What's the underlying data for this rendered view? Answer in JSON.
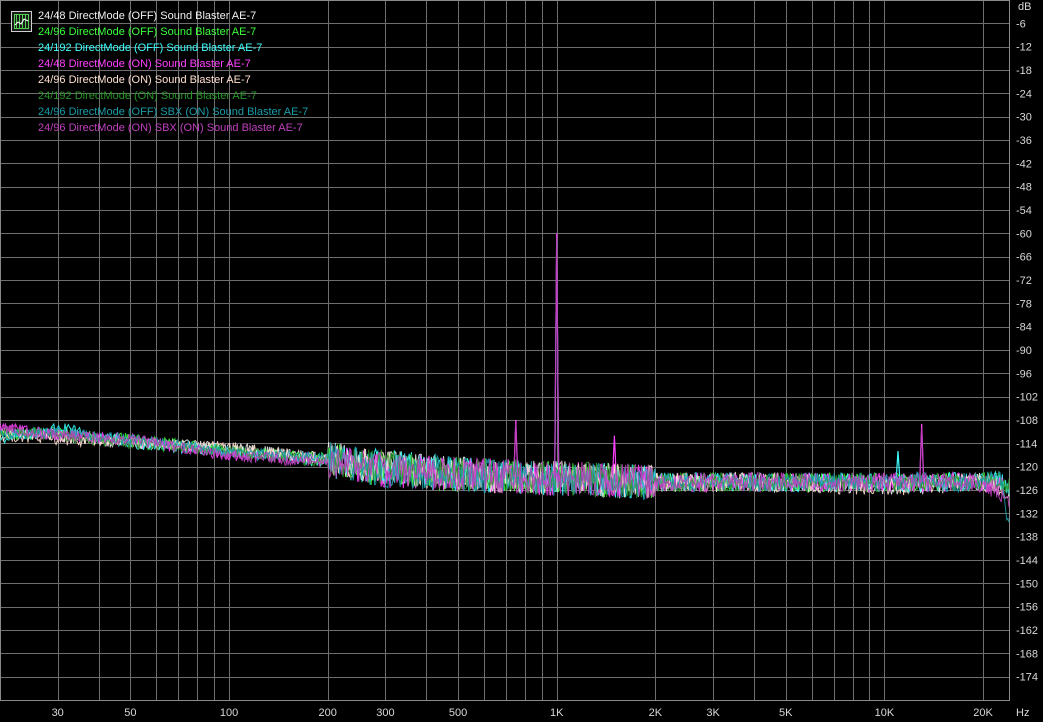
{
  "chart_data": {
    "type": "line",
    "title": "",
    "x_unit": "Hz",
    "y_unit": "dB",
    "x_scale": "log",
    "xlim": [
      20,
      24000
    ],
    "ylim": [
      -180,
      0
    ],
    "grid": true,
    "legend_position": "top-left",
    "x_ticks": [
      {
        "value": 30,
        "label": "30"
      },
      {
        "value": 50,
        "label": "50"
      },
      {
        "value": 100,
        "label": "100"
      },
      {
        "value": 200,
        "label": "200"
      },
      {
        "value": 300,
        "label": "300"
      },
      {
        "value": 500,
        "label": "500"
      },
      {
        "value": 1000,
        "label": "1K"
      },
      {
        "value": 2000,
        "label": "2K"
      },
      {
        "value": 3000,
        "label": "3K"
      },
      {
        "value": 5000,
        "label": "5K"
      },
      {
        "value": 10000,
        "label": "10K"
      },
      {
        "value": 20000,
        "label": "20K"
      }
    ],
    "y_ticks": [
      -6,
      -12,
      -18,
      -24,
      -30,
      -36,
      -42,
      -48,
      -54,
      -60,
      -66,
      -72,
      -78,
      -84,
      -90,
      -96,
      -102,
      -108,
      -114,
      -120,
      -126,
      -132,
      -138,
      -144,
      -150,
      -156,
      -162,
      -168,
      -174
    ],
    "series": [
      {
        "name": "24/48 DirectMode (OFF) Sound Blaster AE-7",
        "color": "#f0f0f0",
        "points": [
          [
            20,
            -111
          ],
          [
            30,
            -112
          ],
          [
            50,
            -114
          ],
          [
            100,
            -115
          ],
          [
            200,
            -118
          ],
          [
            300,
            -120
          ],
          [
            500,
            -122
          ],
          [
            1000,
            -123
          ],
          [
            2000,
            -124
          ],
          [
            5000,
            -124
          ],
          [
            10000,
            -125
          ],
          [
            20000,
            -124
          ],
          [
            23000,
            -125
          ]
        ],
        "spikes": []
      },
      {
        "name": "24/96 DirectMode (OFF) Sound Blaster AE-7",
        "color": "#3cff3c",
        "points": [
          [
            20,
            -112
          ],
          [
            30,
            -111
          ],
          [
            50,
            -113
          ],
          [
            100,
            -116
          ],
          [
            200,
            -118
          ],
          [
            300,
            -121
          ],
          [
            500,
            -122
          ],
          [
            1000,
            -123
          ],
          [
            2000,
            -124
          ],
          [
            5000,
            -124
          ],
          [
            10000,
            -124
          ],
          [
            20000,
            -124
          ],
          [
            22500,
            -123
          ],
          [
            24000,
            -127
          ]
        ],
        "spikes": []
      },
      {
        "name": "24/192 DirectMode (OFF) Sound Blaster AE-7",
        "color": "#3cffff",
        "points": [
          [
            20,
            -113
          ],
          [
            30,
            -110
          ],
          [
            50,
            -114
          ],
          [
            100,
            -116
          ],
          [
            200,
            -119
          ],
          [
            300,
            -120
          ],
          [
            500,
            -122
          ],
          [
            1000,
            -123
          ],
          [
            2000,
            -124
          ],
          [
            5000,
            -124
          ],
          [
            10000,
            -124
          ],
          [
            20000,
            -124
          ],
          [
            22500,
            -123
          ],
          [
            24000,
            -126
          ]
        ],
        "spikes": [
          [
            11000,
            -116
          ]
        ]
      },
      {
        "name": "24/48 DirectMode (ON) Sound Blaster AE-7",
        "color": "#ff40ff",
        "points": [
          [
            20,
            -110
          ],
          [
            30,
            -112
          ],
          [
            50,
            -113
          ],
          [
            100,
            -117
          ],
          [
            200,
            -118
          ],
          [
            300,
            -121
          ],
          [
            500,
            -122
          ],
          [
            1000,
            -123
          ],
          [
            2000,
            -124
          ],
          [
            5000,
            -124
          ],
          [
            10000,
            -124
          ],
          [
            20000,
            -124
          ],
          [
            23000,
            -125
          ]
        ],
        "spikes": [
          [
            1000,
            -60
          ],
          [
            750,
            -108
          ],
          [
            1500,
            -112
          ],
          [
            13000,
            -109
          ]
        ]
      },
      {
        "name": "24/96 DirectMode (ON) Sound Blaster AE-7",
        "color": "#ffe0d0",
        "points": [
          [
            20,
            -112
          ],
          [
            30,
            -113
          ],
          [
            50,
            -114
          ],
          [
            100,
            -115
          ],
          [
            200,
            -118
          ],
          [
            300,
            -120
          ],
          [
            500,
            -122
          ],
          [
            1000,
            -123
          ],
          [
            2000,
            -124
          ],
          [
            5000,
            -124
          ],
          [
            10000,
            -125
          ],
          [
            20000,
            -124
          ],
          [
            24000,
            -126
          ]
        ],
        "spikes": []
      },
      {
        "name": "24/192 DirectMode (ON) Sound Blaster AE-7",
        "color": "#289628",
        "points": [
          [
            20,
            -111
          ],
          [
            30,
            -112
          ],
          [
            50,
            -114
          ],
          [
            100,
            -116
          ],
          [
            200,
            -119
          ],
          [
            300,
            -120
          ],
          [
            500,
            -122
          ],
          [
            1000,
            -123
          ],
          [
            2000,
            -124
          ],
          [
            5000,
            -124
          ],
          [
            10000,
            -124
          ],
          [
            20000,
            -124
          ],
          [
            24000,
            -125
          ]
        ],
        "spikes": []
      },
      {
        "name": "24/96 DirectMode (OFF) SBX (ON) Sound Blaster AE-7",
        "color": "#1a9aa8",
        "points": [
          [
            20,
            -112
          ],
          [
            30,
            -111
          ],
          [
            50,
            -113
          ],
          [
            100,
            -116
          ],
          [
            200,
            -118
          ],
          [
            300,
            -121
          ],
          [
            500,
            -122
          ],
          [
            1000,
            -123
          ],
          [
            2000,
            -124
          ],
          [
            5000,
            -124
          ],
          [
            10000,
            -124
          ],
          [
            20000,
            -124
          ],
          [
            22500,
            -123
          ],
          [
            24000,
            -134
          ]
        ],
        "spikes": [
          [
            1000,
            -62
          ]
        ]
      },
      {
        "name": "24/96 DirectMode (ON) SBX (ON) Sound Blaster AE-7",
        "color": "#c040c0",
        "points": [
          [
            20,
            -110
          ],
          [
            30,
            -112
          ],
          [
            50,
            -113
          ],
          [
            100,
            -117
          ],
          [
            200,
            -119
          ],
          [
            300,
            -120
          ],
          [
            500,
            -122
          ],
          [
            1000,
            -123
          ],
          [
            2000,
            -124
          ],
          [
            5000,
            -124
          ],
          [
            10000,
            -124
          ],
          [
            20000,
            -124
          ],
          [
            24000,
            -128
          ]
        ],
        "spikes": [
          [
            1000,
            -61
          ],
          [
            750,
            -109
          ],
          [
            13000,
            -110
          ]
        ]
      }
    ]
  }
}
